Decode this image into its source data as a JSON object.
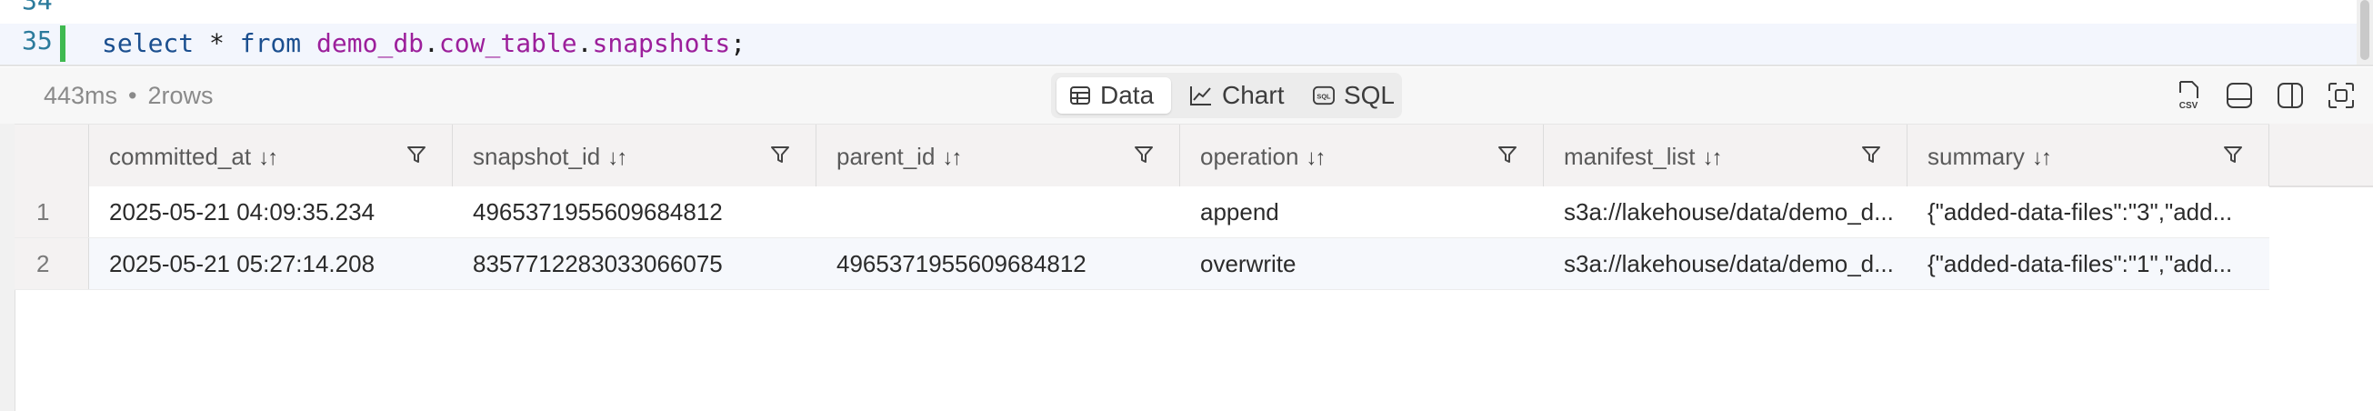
{
  "editor": {
    "prev_line_number": "34",
    "line_number": "35",
    "tokens": {
      "select": "select",
      "star": "*",
      "from": "from",
      "db": "demo_db",
      "dot1": ".",
      "table": "cow_table",
      "dot2": ".",
      "obj": "snapshots",
      "semi": ";"
    }
  },
  "results": {
    "elapsed": "443ms",
    "separator": "•",
    "row_count": "2rows",
    "tabs": [
      {
        "label": "Data",
        "icon": "table-icon",
        "active": true
      },
      {
        "label": "Chart",
        "icon": "line-chart-icon",
        "active": false
      },
      {
        "label": "SQL",
        "icon": "sql-icon",
        "active": false
      }
    ],
    "tools": [
      "csv-export-icon",
      "panel-bottom-icon",
      "panel-right-icon",
      "expand-icon"
    ],
    "csv_label": "CSV",
    "sql_badge": "SQL"
  },
  "grid": {
    "sort_glyph": "↓↑",
    "columns": [
      "committed_at",
      "snapshot_id",
      "parent_id",
      "operation",
      "manifest_list",
      "summary"
    ],
    "rows": [
      {
        "num": "1",
        "cells": [
          "2025-05-21 04:09:35.234",
          "4965371955609684812",
          "",
          "append",
          "s3a://lakehouse/data/demo_d...",
          "{\"added-data-files\":\"3\",\"add..."
        ]
      },
      {
        "num": "2",
        "cells": [
          "2025-05-21 05:27:14.208",
          "8357712283033066075",
          "4965371955609684812",
          "overwrite",
          "s3a://lakehouse/data/demo_d...",
          "{\"added-data-files\":\"1\",\"add..."
        ]
      }
    ]
  }
}
